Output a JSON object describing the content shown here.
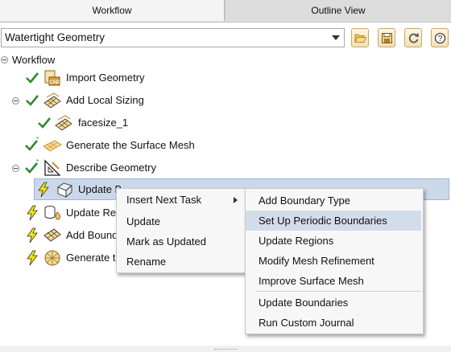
{
  "tabs": {
    "workflow": "Workflow",
    "outline": "Outline View"
  },
  "toolbar": {
    "workflow_type": "Watertight Geometry",
    "buttons": [
      "open-folder-icon",
      "save-icon",
      "refresh-icon",
      "help-icon"
    ],
    "help_glyph": "?"
  },
  "tree": {
    "root": "Workflow",
    "items": [
      {
        "label": "Import Geometry",
        "status": "done"
      },
      {
        "label": "Add Local Sizing",
        "status": "done"
      },
      {
        "label": "facesize_1",
        "status": "done"
      },
      {
        "label": "Generate the Surface Mesh",
        "status": "done-updated"
      },
      {
        "label": "Describe Geometry",
        "status": "done-updated"
      },
      {
        "label": "Update Boundaries",
        "status": "pending"
      },
      {
        "label": "Update Regions",
        "status": "pending"
      },
      {
        "label": "Add Boundary Layers",
        "status": "pending"
      },
      {
        "label": "Generate the Volume Mesh",
        "status": "pending"
      }
    ],
    "visible": {
      "item5": "Update B",
      "item5_tail": "",
      "item6": "Update Re",
      "item7": "Add Bound",
      "item8": "Generate t"
    }
  },
  "context_menu": {
    "items": [
      "Insert Next Task",
      "Update",
      "Mark as Updated",
      "Rename"
    ]
  },
  "submenu": {
    "items": [
      "Add Boundary Type",
      "Set Up Periodic Boundaries",
      "Update Regions",
      "Modify Mesh Refinement",
      "Improve Surface Mesh",
      "Update Boundaries",
      "Run Custom Journal"
    ],
    "highlighted": "Set Up Periodic Boundaries"
  },
  "colors": {
    "check": "#2e8b2e",
    "bolt": "#f2e600",
    "selection": "#cbd8ea",
    "accent": "#c6a86b"
  }
}
